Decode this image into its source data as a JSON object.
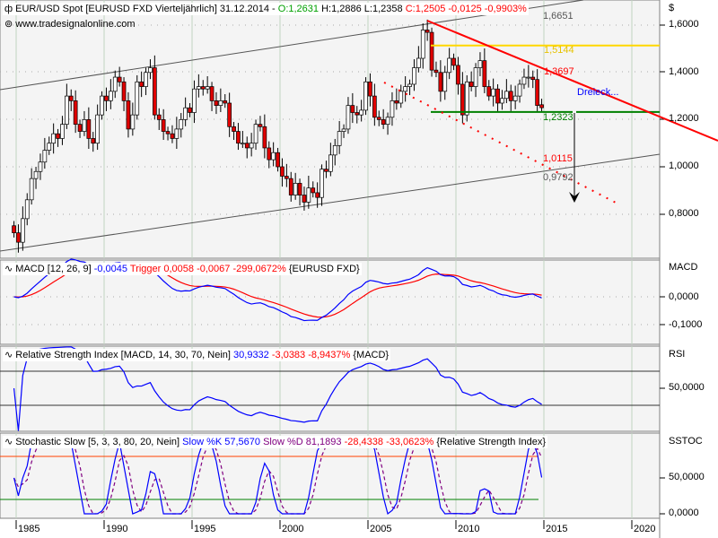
{
  "header": {
    "symbol_icon": "candle-icon",
    "title": "EUR/USD Spot [EURUSD FXD  Vierteljährlich] 31.12.2014 -",
    "open": "O:1,2631",
    "high_low": "H:1,2886 L:1,2358",
    "close_change": "C:1,2505 -0,0125 -0,9903%",
    "copyright_icon": "copyright-icon",
    "website": "www.tradesignalonline.com"
  },
  "annotations": {
    "upper_channel": "1,6651",
    "resistance": "1,5144",
    "trendline": "1,3697",
    "pattern": "Dreieck...",
    "support": "1,2323",
    "lower_dotted": "1,0115",
    "lower_channel": "0,9792"
  },
  "colors": {
    "resistance": "#ffd700",
    "support": "#008000",
    "trend": "#ff0000",
    "macd": "#0000ff",
    "trigger": "#ff0000",
    "slowd": "#800080",
    "bull": "#ffffff",
    "bear": "#e00000"
  },
  "macd_panel": {
    "name": "MACD [12, 26, 9]",
    "value": "-0,0045",
    "trigger": "Trigger 0,0058",
    "change": "-0,0067 -299,0672%",
    "source": "{EURUSD FXD}",
    "axis_title": "MACD",
    "ticks": [
      "0,0000",
      "-0,1000"
    ]
  },
  "rsi_panel": {
    "name": "Relative Strength Index [MACD, 14, 30, 70, Nein]",
    "value": "30,9332",
    "change": "-3,0383 -8,9437%",
    "source": "{MACD}",
    "axis_title": "RSI",
    "ticks": [
      "50,0000"
    ]
  },
  "stoch_panel": {
    "name": "Stochastic Slow [5, 3, 3, 80, 20, Nein]",
    "slowk": "Slow %K 57,5670",
    "slowd": "Slow %D 81,1893",
    "change": "-28,4338 -33,0623%",
    "source": "{Relative Strength Index}",
    "axis_title": "SSTOC",
    "ticks": [
      "50,0000",
      "0,0000"
    ]
  },
  "price_axis": {
    "currency": "$",
    "ticks": [
      "1,6000",
      "1,4000",
      "1,2000",
      "1,0000",
      "0,8000"
    ]
  },
  "chart_data": {
    "type": "candlestick",
    "title": "EUR/USD Spot quarterly",
    "start_quarter": "1984Q4",
    "x_ticks": [
      "1985",
      "1990",
      "1995",
      "2000",
      "2005",
      "2010",
      "2015",
      "2020"
    ],
    "ylim": [
      0.62,
      1.7
    ],
    "closes": [
      0.72,
      0.68,
      0.78,
      0.86,
      0.95,
      0.98,
      1.02,
      1.07,
      1.1,
      1.14,
      1.12,
      1.18,
      1.3,
      1.28,
      1.18,
      1.15,
      1.2,
      1.12,
      1.1,
      1.22,
      1.3,
      1.28,
      1.32,
      1.38,
      1.36,
      1.28,
      1.16,
      1.22,
      1.36,
      1.34,
      1.4,
      1.42,
      1.22,
      1.2,
      1.15,
      1.14,
      1.12,
      1.16,
      1.2,
      1.25,
      1.23,
      1.33,
      1.34,
      1.33,
      1.34,
      1.28,
      1.26,
      1.28,
      1.27,
      1.17,
      1.15,
      1.1,
      1.1,
      1.08,
      1.1,
      1.18,
      1.17,
      1.08,
      1.03,
      1.06,
      1.0,
      0.96,
      0.95,
      0.88,
      0.93,
      0.88,
      0.85,
      0.91,
      0.89,
      0.87,
      0.99,
      0.98,
      1.05,
      1.09,
      1.15,
      1.16,
      1.26,
      1.23,
      1.22,
      1.24,
      1.36,
      1.3,
      1.21,
      1.2,
      1.18,
      1.21,
      1.28,
      1.27,
      1.32,
      1.34,
      1.35,
      1.42,
      1.46,
      1.58,
      1.57,
      1.41,
      1.4,
      1.32,
      1.4,
      1.46,
      1.43,
      1.35,
      1.22,
      1.36,
      1.34,
      1.42,
      1.45,
      1.34,
      1.3,
      1.33,
      1.27,
      1.29,
      1.32,
      1.28,
      1.3,
      1.35,
      1.38,
      1.38,
      1.37,
      1.26,
      1.2505
    ],
    "last_candle": {
      "open": 1.2631,
      "high": 1.2886,
      "low": 1.2358,
      "close": 1.2505
    },
    "levels": {
      "resistance": 1.5144,
      "support": 1.2323,
      "target": 0.9792
    },
    "rsi_bands": [
      30,
      70
    ],
    "stoch_bands": [
      20,
      80
    ]
  }
}
